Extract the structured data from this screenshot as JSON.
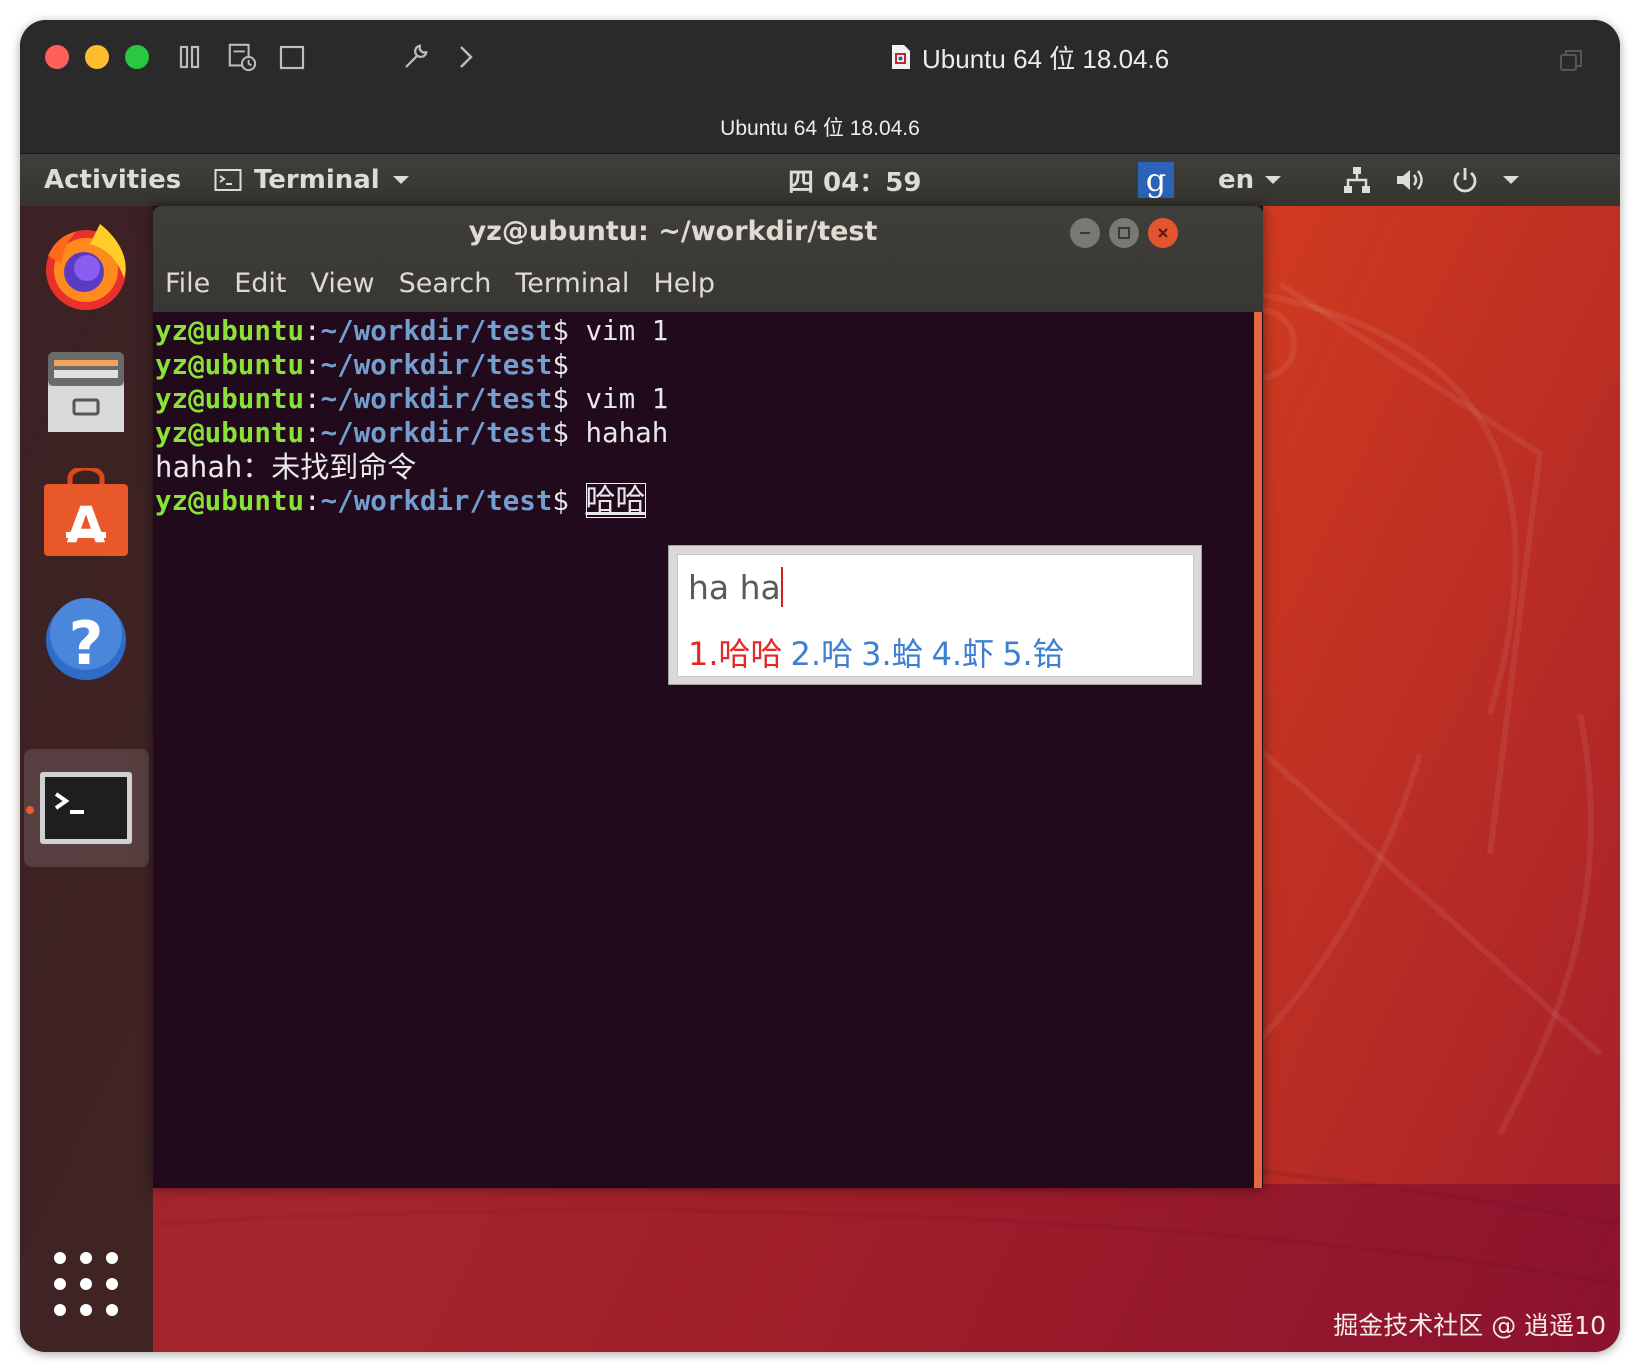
{
  "host": {
    "vm_title": "Ubuntu 64 位 18.04.6",
    "vm_subtitle": "Ubuntu 64 位 18.04.6"
  },
  "top_panel": {
    "activities": "Activities",
    "app_menu": "Terminal",
    "clock": "四 04：59",
    "ime_indicator": "g",
    "keyboard_layout": "en"
  },
  "dock": {
    "items": [
      "firefox-icon",
      "files-icon",
      "software-center-icon",
      "help-icon",
      "terminal-icon",
      "show-applications-icon"
    ]
  },
  "terminal": {
    "title": "yz@ubuntu: ~/workdir/test",
    "menu": [
      "File",
      "Edit",
      "View",
      "Search",
      "Terminal",
      "Help"
    ],
    "prompt_user": "yz@ubuntu",
    "prompt_colon": ":",
    "prompt_path": "~/workdir/test",
    "prompt_dollar": "$",
    "lines": [
      {
        "type": "prompt",
        "command": " vim 1"
      },
      {
        "type": "prompt",
        "command": ""
      },
      {
        "type": "prompt",
        "command": " vim 1"
      },
      {
        "type": "prompt",
        "command": " hahah"
      },
      {
        "type": "output",
        "text": "hahah：未找到命令"
      },
      {
        "type": "prompt",
        "command": " ",
        "preedit": "哈哈"
      }
    ]
  },
  "ime_popup": {
    "input": "ha ha",
    "candidates": [
      "1.哈哈",
      "2.哈",
      "3.蛤",
      "4.虾",
      "5.铪"
    ],
    "selected_index": 0
  },
  "watermark": "掘金技术社区 @ 逍遥10",
  "colors": {
    "prompt_user": "#8ae234",
    "prompt_path": "#729fcf",
    "terminal_bg": "#210a1c",
    "candidate_active": "#e12a2a",
    "candidate": "#3e7fd1"
  }
}
